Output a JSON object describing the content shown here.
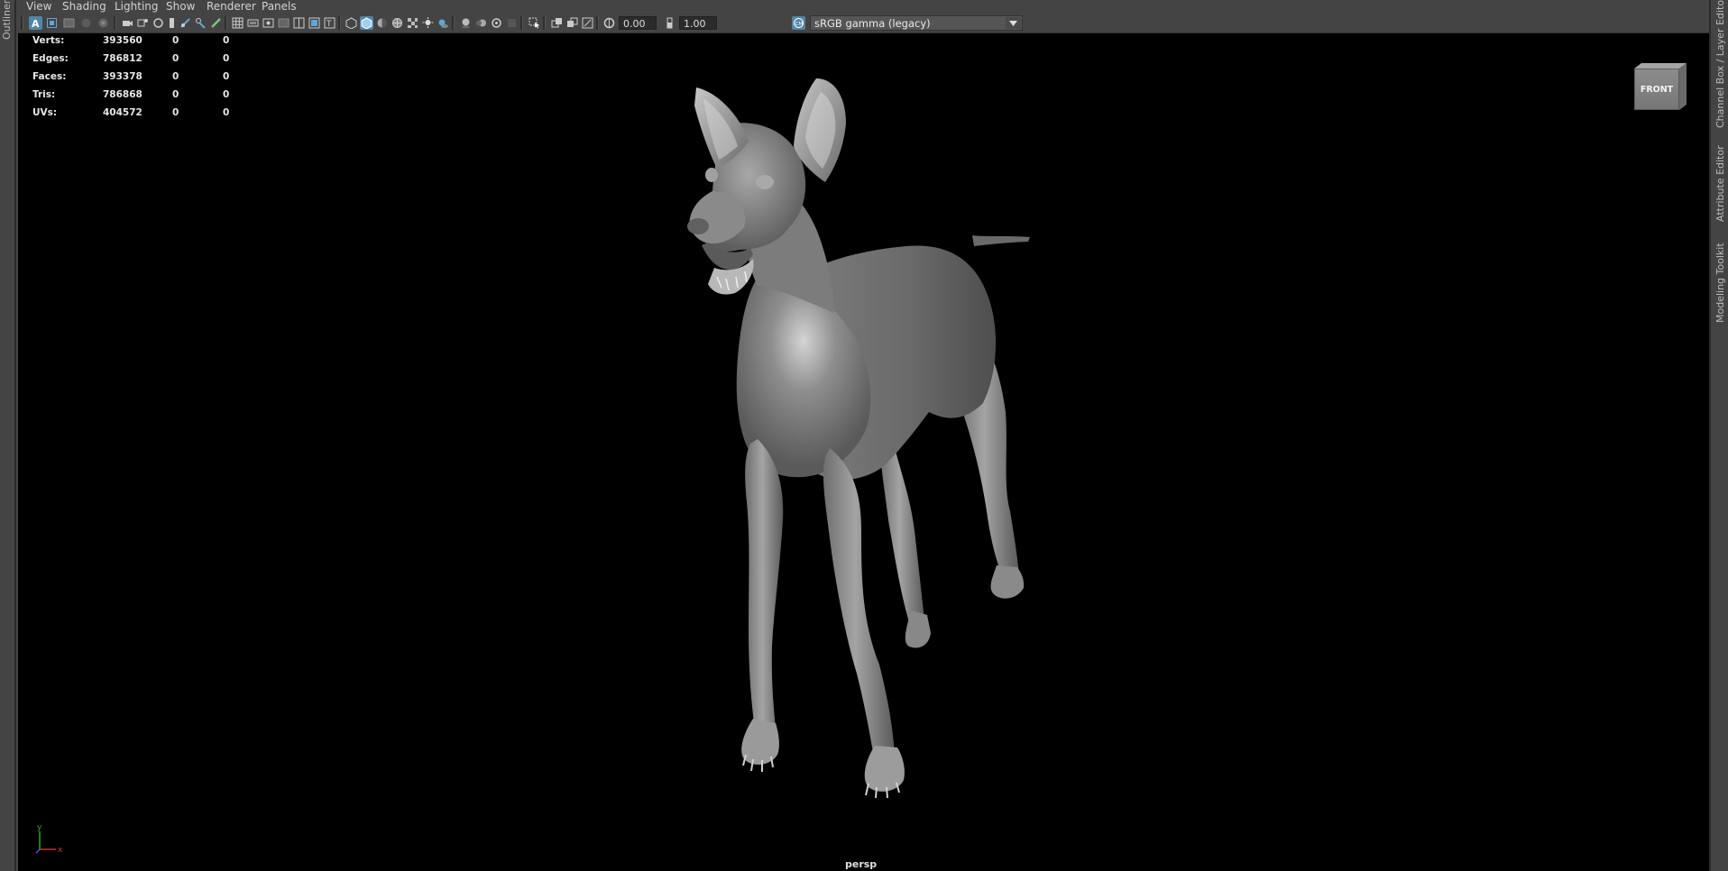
{
  "side_panels": {
    "left": "Outliner",
    "right": [
      "Channel Box / Layer Editor",
      "Attribute Editor",
      "Modeling Toolkit"
    ]
  },
  "menu": [
    "View",
    "Shading",
    "Lighting",
    "Show",
    "Renderer",
    "Panels"
  ],
  "toolbar": {
    "exposure_value": "0.00",
    "gamma_value": "1.00",
    "color_space": "sRGB gamma (legacy)"
  },
  "hud_stats": [
    {
      "label": "Verts:",
      "object": "393560",
      "selected": "0",
      "component": "0"
    },
    {
      "label": "Edges:",
      "object": "786812",
      "selected": "0",
      "component": "0"
    },
    {
      "label": "Faces:",
      "object": "393378",
      "selected": "0",
      "component": "0"
    },
    {
      "label": "Tris:",
      "object": "786868",
      "selected": "0",
      "component": "0"
    },
    {
      "label": "UVs:",
      "object": "404572",
      "selected": "0",
      "component": "0"
    }
  ],
  "viewcube_label": "FRONT",
  "camera_label": "persp",
  "axis_labels": {
    "y": "y",
    "x": "x"
  },
  "colors": {
    "viewport_bg": "#000000",
    "ui_bg": "#444444",
    "active_tool": "#5285a6",
    "model_gray": "#7a7a7a"
  }
}
